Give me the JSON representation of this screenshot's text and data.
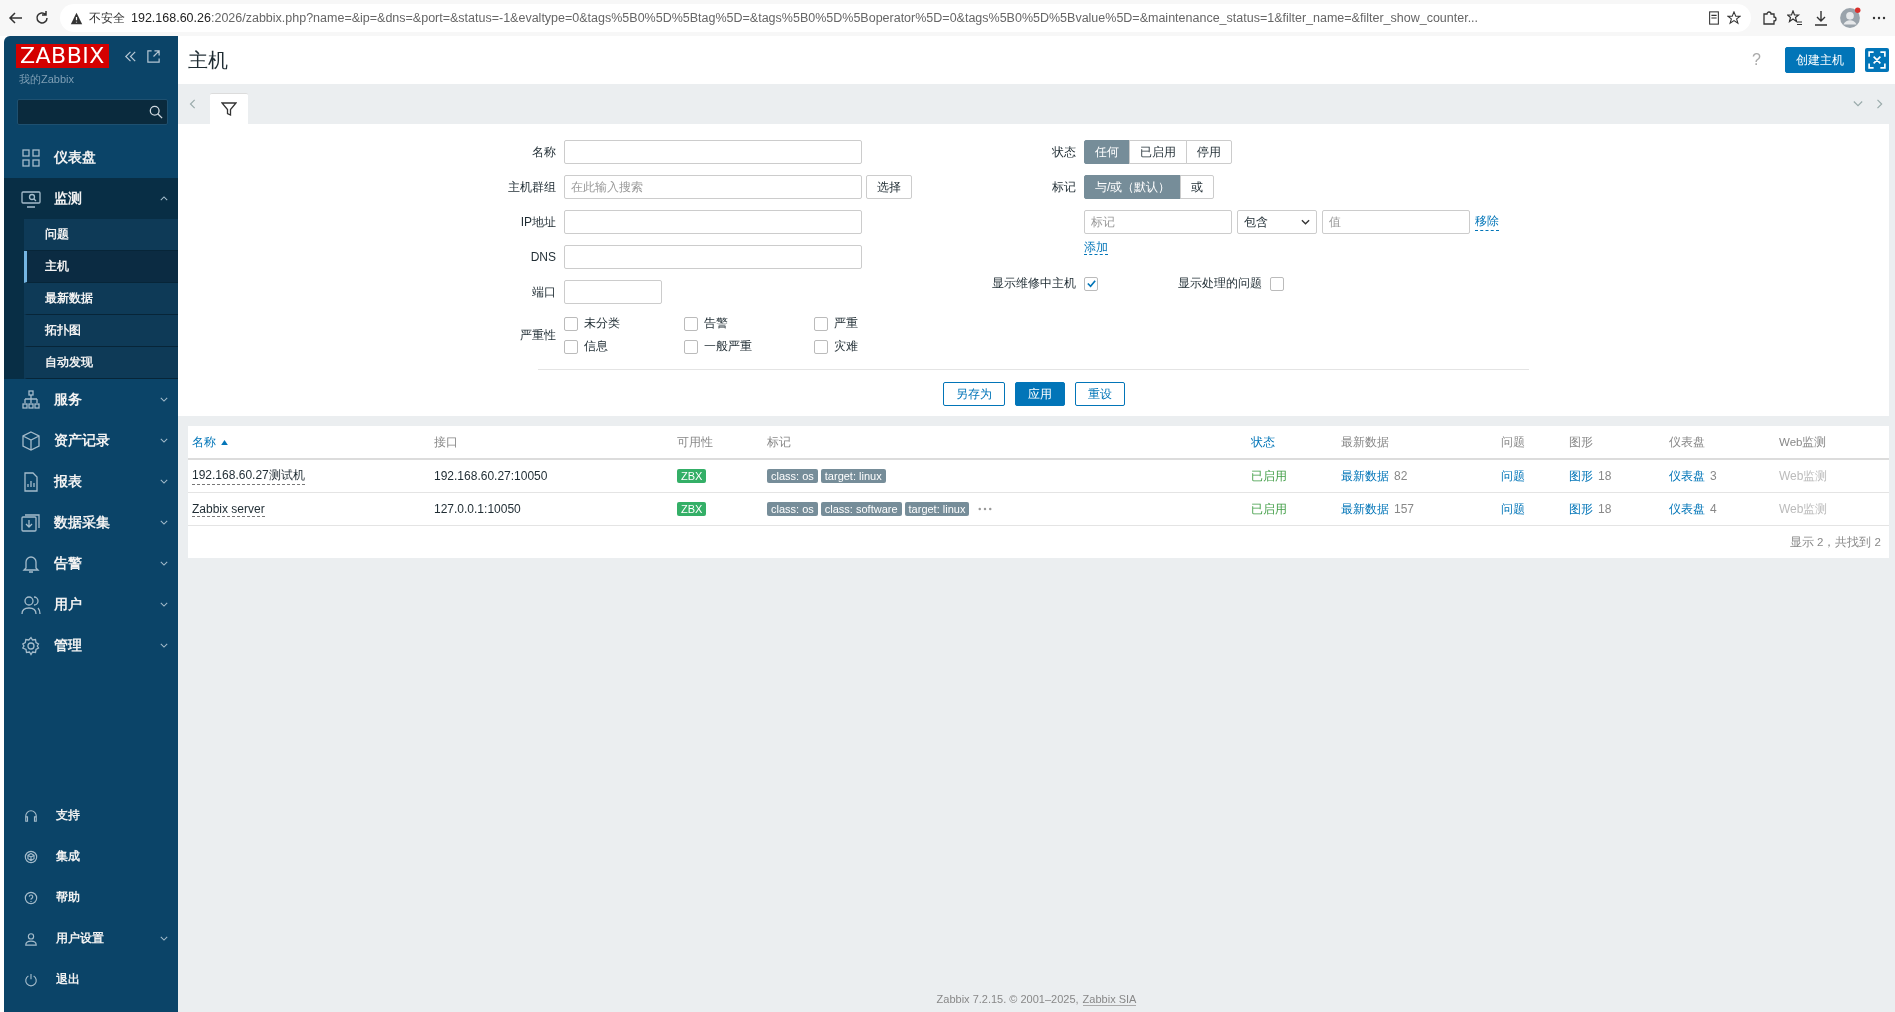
{
  "browser": {
    "security_label": "不安全",
    "url_host": "192.168.60.26",
    "url_rest": ":2026/zabbix.php?name=&ip=&dns=&port=&status=-1&evaltype=0&tags%5B0%5D%5Btag%5D=&tags%5B0%5D%5Boperator%5D=0&tags%5B0%5D%5Bvalue%5D=&maintenance_status=1&filter_name=&filter_show_counter..."
  },
  "sidebar": {
    "logo": "ZABBIX",
    "subtitle": "我的Zabbix",
    "menu": [
      {
        "label": "仪表盘",
        "kind": "link",
        "expanded": false
      },
      {
        "label": "监测",
        "kind": "group",
        "expanded": true,
        "children": [
          {
            "label": "问题",
            "selected": false
          },
          {
            "label": "主机",
            "selected": true
          },
          {
            "label": "最新数据",
            "selected": false
          },
          {
            "label": "拓扑图",
            "selected": false
          },
          {
            "label": "自动发现",
            "selected": false
          }
        ]
      },
      {
        "label": "服务",
        "kind": "group",
        "expanded": false
      },
      {
        "label": "资产记录",
        "kind": "group",
        "expanded": false
      },
      {
        "label": "报表",
        "kind": "group",
        "expanded": false
      },
      {
        "label": "数据采集",
        "kind": "group",
        "expanded": false
      },
      {
        "label": "告警",
        "kind": "group",
        "expanded": false
      },
      {
        "label": "用户",
        "kind": "group",
        "expanded": false
      },
      {
        "label": "管理",
        "kind": "group",
        "expanded": false
      }
    ],
    "bottom_menu": [
      {
        "label": "支持",
        "kind": "link"
      },
      {
        "label": "集成",
        "kind": "link"
      },
      {
        "label": "帮助",
        "kind": "link"
      },
      {
        "label": "用户设置",
        "kind": "group"
      },
      {
        "label": "退出",
        "kind": "link"
      }
    ]
  },
  "header": {
    "title": "主机",
    "help": "?",
    "create_button": "创建主机"
  },
  "filter": {
    "left": [
      {
        "label": "名称",
        "kind": "input"
      },
      {
        "label": "主机群组",
        "kind": "multiselect",
        "placeholder": "在此输入搜索",
        "button": "选择"
      },
      {
        "label": "IP地址",
        "kind": "input"
      },
      {
        "label": "DNS",
        "kind": "input"
      },
      {
        "label": "端口",
        "kind": "short"
      }
    ],
    "severity": {
      "label": "严重性",
      "options": [
        {
          "label": "未分类",
          "checked": false
        },
        {
          "label": "告警",
          "checked": false
        },
        {
          "label": "严重",
          "checked": false
        },
        {
          "label": "信息",
          "checked": false
        },
        {
          "label": "一般严重",
          "checked": false
        },
        {
          "label": "灾难",
          "checked": false
        }
      ]
    },
    "status": {
      "label": "状态",
      "options": [
        {
          "label": "任何",
          "selected": true
        },
        {
          "label": "已启用",
          "selected": false
        },
        {
          "label": "停用",
          "selected": false
        }
      ]
    },
    "tags": {
      "label": "标记",
      "options": [
        {
          "label": "与/或（默认）",
          "selected": true
        },
        {
          "label": "或",
          "selected": false
        }
      ],
      "tag_placeholder": "标记",
      "operator": "包含",
      "value_placeholder": "值",
      "remove": "移除",
      "add": "添加"
    },
    "checks": [
      {
        "label": "显示维修中主机",
        "checked": true
      },
      {
        "label": "显示处理的问题",
        "checked": false
      }
    ],
    "buttons": [
      {
        "label": "另存为",
        "kind": "secondary"
      },
      {
        "label": "应用",
        "kind": "primary"
      },
      {
        "label": "重设",
        "kind": "secondary"
      }
    ]
  },
  "table": {
    "columns": [
      {
        "label": "名称",
        "sortable": true,
        "sorted": true
      },
      {
        "label": "接口",
        "sortable": false,
        "sorted": false
      },
      {
        "label": "可用性",
        "sortable": false,
        "sorted": false
      },
      {
        "label": "标记",
        "sortable": false,
        "sorted": false
      },
      {
        "label": "状态",
        "sortable": true,
        "sorted": false
      },
      {
        "label": "最新数据",
        "sortable": false,
        "sorted": false
      },
      {
        "label": "问题",
        "sortable": false,
        "sorted": false
      },
      {
        "label": "图形",
        "sortable": false,
        "sorted": false
      },
      {
        "label": "仪表盘",
        "sortable": false,
        "sorted": false
      },
      {
        "label": "Web监测",
        "sortable": false,
        "sorted": false
      }
    ],
    "rows": [
      {
        "name": "192.168.60.27测试机",
        "interface": "192.168.60.27:10050",
        "availability": {
          "label": "ZBX",
          "color": "#34af67"
        },
        "tags": [
          "class: os",
          "target: linux"
        ],
        "more_tags": false,
        "status": "已启用",
        "latest": "最新数据",
        "latest_count": "82",
        "problems": "问题",
        "graphs": "图形",
        "graphs_count": "18",
        "dashboards": "仪表盘",
        "dashboards_count": "3",
        "web": "Web监测"
      },
      {
        "name": "Zabbix server",
        "interface": "127.0.0.1:10050",
        "availability": {
          "label": "ZBX",
          "color": "#34af67"
        },
        "tags": [
          "class: os",
          "class: software",
          "target: linux"
        ],
        "more_tags": true,
        "status": "已启用",
        "latest": "最新数据",
        "latest_count": "157",
        "problems": "问题",
        "graphs": "图形",
        "graphs_count": "18",
        "dashboards": "仪表盘",
        "dashboards_count": "4",
        "web": "Web监测"
      }
    ],
    "footer": "显示 2，共找到 2"
  },
  "page_footer": {
    "text": "Zabbix 7.2.15. © 2001–2025,",
    "link": "Zabbix SIA"
  }
}
